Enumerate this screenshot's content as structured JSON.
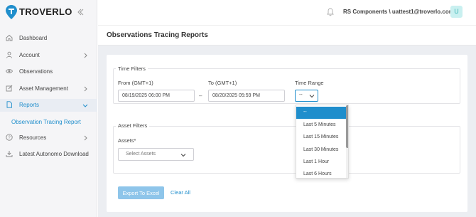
{
  "brand": {
    "name": "TROVERLO",
    "color": "#1f8ecc"
  },
  "sidebar": {
    "items": [
      {
        "label": "Dashboard",
        "icon": "home-icon"
      },
      {
        "label": "Account",
        "icon": "user-icon"
      },
      {
        "label": "Observations",
        "icon": "eye-icon"
      },
      {
        "label": "Asset Management",
        "icon": "edit-icon"
      },
      {
        "label": "Reports",
        "icon": "file-icon"
      },
      {
        "label": "Observation Tracing Report",
        "icon": ""
      },
      {
        "label": "Resources",
        "icon": "help-icon"
      },
      {
        "label": "Latest Autonomo Download",
        "icon": "download-icon"
      }
    ]
  },
  "header": {
    "user": "RS Components \\ uattest1@troverlo.com",
    "avatar_initial": "U"
  },
  "page": {
    "title": "Observations Tracing Reports"
  },
  "time_filters": {
    "legend": "Time Filters",
    "from_label": "From (GMT+1)",
    "from_value": "08/19/2025 06:00 PM",
    "to_label": "To (GMT+1)",
    "to_value": "08/20/2025 05:59 PM",
    "separator": "–",
    "range_label": "Time Range",
    "range_value": "--"
  },
  "asset_filters": {
    "legend": "Asset Filters",
    "assets_label": "Assets*",
    "assets_placeholder": "Select Assets"
  },
  "actions": {
    "export_label": "Export To Excel",
    "clear_label": "Clear All"
  },
  "time_range_options": [
    "--",
    "Last 5 Minutes",
    "Last 15 Minutes",
    "Last 30 Minutes",
    "Last 1 Hour",
    "Last 6 Hours"
  ]
}
